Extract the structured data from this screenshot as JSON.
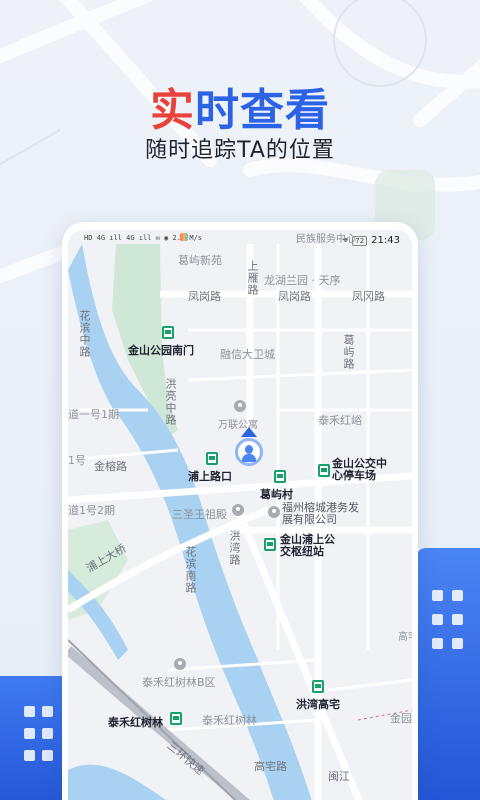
{
  "headline": {
    "first_char": "实",
    "rest": "时查看"
  },
  "subhead": "随时追踪TA的位置",
  "colors": {
    "brand_blue": "#2c63e6",
    "accent_red": "#e8433b",
    "bus_green": "#18a06a"
  },
  "status_bar": {
    "left": "HD 4G ıll 4G ıll ✉ ◉ 2.4 M/s",
    "time": "21:43",
    "battery": "72",
    "icons": [
      "signal-icon",
      "wifi-icon",
      "location-icon",
      "battery-icon"
    ]
  },
  "map": {
    "top_label": "民族服务中心",
    "roads": {
      "fenggang_1": "凤岗路",
      "fenggang_2": "凤岗路",
      "fengfeng": "凤冈路",
      "shangyan": "上雁路",
      "huabin_zhong": "花滨中路",
      "hongxing": "洪亮中路",
      "gexu": "葛屿路",
      "jinrong": "金榕路",
      "pushang_bridge": "浦上大桥",
      "huabin_south": "花滨南路",
      "hongwan": "洪湾路",
      "sanhuan": "三环快速",
      "gaozhai": "高宅路",
      "minjiang": "闽江"
    },
    "areas": {
      "gexu_xinyuan": "葛屿新苑",
      "longhu": "龙湖兰园 · 天序",
      "ronxin": "融信大卫城",
      "taihe": "泰禾红峪",
      "dao_no1": "道一号1期",
      "no1": "1号",
      "dao_no1_2": "道1号2期",
      "sansheng": "三圣王祖殿",
      "taihe_b": "泰禾红树林B区",
      "taihe_lin": "泰禾红树林",
      "gaozhai_nong": "高宅农贸",
      "jinyuan": "金园"
    },
    "pois": {
      "jinshan_park": "金山公园南门",
      "wanlian": "万联公寓",
      "pushang_kou": "浦上路口",
      "gexu_cun": "葛屿村",
      "jinshan_bus": "金山公交中心停车场",
      "fuzhou_co": "福州榕城港务发展有限公司",
      "jinshan_hub": "金山浦上公交枢纽站",
      "hongwan_gaozhai": "洪湾高宅",
      "taihe_stop": "泰禾红树林"
    }
  }
}
